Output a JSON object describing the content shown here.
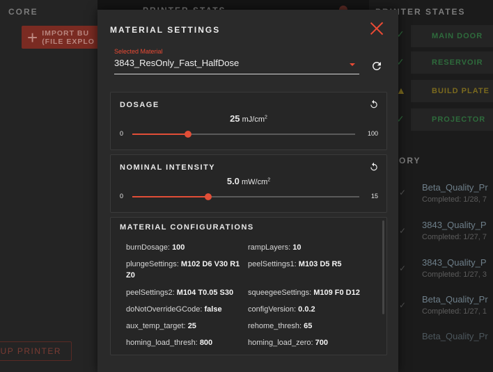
{
  "background": {
    "left_title": "CORE",
    "import_button": "IMPORT BU\n(FILE EXPLO",
    "setup_button": "UP PRINTER",
    "center_title": "PRINTER STATS",
    "printer_states_title": "PRINTER STATES",
    "states": [
      {
        "label": "MAIN DOOR",
        "color": "#2e6b3c",
        "icon": "check-icon"
      },
      {
        "label": "RESERVOIR",
        "color": "#2e6b3c",
        "icon": "check-icon"
      },
      {
        "label": "BUILD PLATE",
        "color": "#7b6a1e",
        "icon": "warning-icon"
      },
      {
        "label": "PROJECTOR",
        "color": "#2e6b3c",
        "icon": "check-icon"
      }
    ],
    "history_title": "ORY",
    "history": [
      {
        "name": "Beta_Quality_Pr",
        "sub": "Completed: 1/28, 7"
      },
      {
        "name": "3843_Quality_P",
        "sub": "Completed: 1/27, 7"
      },
      {
        "name": "3843_Quality_P",
        "sub": "Completed: 1/27, 3"
      },
      {
        "name": "Beta_Quality_Pr",
        "sub": "Completed: 1/27, 1"
      },
      {
        "name": "Beta_Quality_Pr",
        "sub": ""
      }
    ]
  },
  "modal": {
    "title": "MATERIAL SETTINGS",
    "select_label": "Selected Material",
    "selected_material": "3843_ResOnly_Fast_HalfDose",
    "accent": "#ea4a34",
    "dosage": {
      "title": "DOSAGE",
      "value": "25",
      "unit": "mJ/cm",
      "unit_sup": "2",
      "min": "0",
      "max": "100",
      "level": 25
    },
    "intensity": {
      "title": "NOMINAL INTENSITY",
      "value": "5.0",
      "unit": "mW/cm",
      "unit_sup": "2",
      "min": "0",
      "max": "15",
      "level": 5
    },
    "config": {
      "title": "MATERIAL CONFIGURATIONS",
      "items": [
        {
          "key": "burnDosage:",
          "value": "100"
        },
        {
          "key": "rampLayers:",
          "value": "10"
        },
        {
          "key": "plungeSettings:",
          "value": "M102 D6 V30 R1",
          "value2": "Z0"
        },
        {
          "key": "peelSettings1:",
          "value": "M103 D5 R5"
        },
        {
          "key": "peelSettings2:",
          "value": "M104 T0.05 S30"
        },
        {
          "key": "squeegeeSettings:",
          "value": "M109 F0 D12"
        },
        {
          "key": "doNotOverrideGCode:",
          "value": "false"
        },
        {
          "key": "configVersion:",
          "value": "0.0.2"
        },
        {
          "key": "aux_temp_target:",
          "value": "25"
        },
        {
          "key": "rehome_thresh:",
          "value": "65"
        },
        {
          "key": "homing_load_thresh:",
          "value": "800"
        },
        {
          "key": "homing_load_zero:",
          "value": "700"
        }
      ]
    }
  }
}
